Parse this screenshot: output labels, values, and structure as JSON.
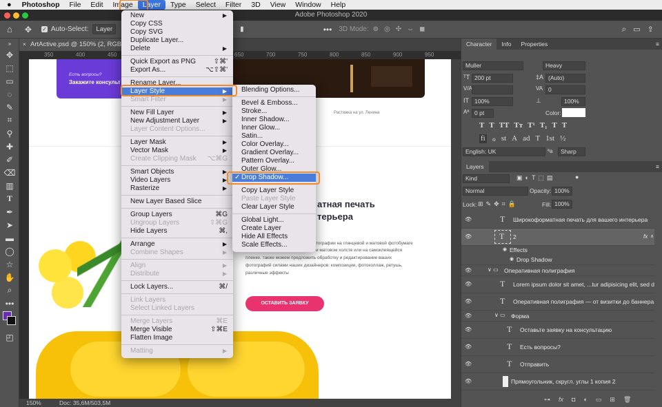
{
  "menubar": {
    "apple": "",
    "items": [
      "Photoshop",
      "File",
      "Edit",
      "Image",
      "Layer",
      "Type",
      "Select",
      "Filter",
      "3D",
      "View",
      "Window",
      "Help"
    ]
  },
  "window": {
    "title": "Adobe Photoshop 2020"
  },
  "options_bar": {
    "auto_select_label": "Auto-Select:",
    "auto_select_value": "Layer",
    "mode_label": "3D Mode:"
  },
  "document": {
    "tab_title": "ArtActive.psd @ 150% (2, RGB/8) *",
    "ruler_ticks": [
      "350",
      "400",
      "450",
      "500",
      "550",
      "600",
      "650",
      "700",
      "750",
      "800",
      "850",
      "900",
      "950"
    ]
  },
  "status": {
    "zoom": "150%",
    "doc": "Doc: 35,6M/503,5M"
  },
  "canvas": {
    "card_small": "Есть вопросы?",
    "card_big": "Закажите консульт",
    "photo_caption": "Растяжка на ул. Ленина",
    "heading_line1": "атная печать",
    "heading_line2": "терьера",
    "body_lines": [
      "тографии на глянцевой и матовой фотобумаге",
      "и матовом холсте или на самоклеящейся",
      "пленке. также можем предложить обработку и редактирование ваших",
      "фотографий силами наших дизайнеров: композиции, фотоколлаж, ретушь,",
      "различные эффекты"
    ],
    "cta": "ОСТАВИТЬ ЗАЯВКУ"
  },
  "layer_menu": [
    {
      "label": "New",
      "arrow": true
    },
    {
      "label": "Copy CSS"
    },
    {
      "label": "Copy SVG"
    },
    {
      "label": "Duplicate Layer..."
    },
    {
      "label": "Delete",
      "arrow": true
    },
    {
      "sep": true
    },
    {
      "label": "Quick Export as PNG",
      "sc": "⇧⌘'"
    },
    {
      "label": "Export As...",
      "sc": "⌥⇧⌘'"
    },
    {
      "sep": true
    },
    {
      "label": "Rename Layer..."
    },
    {
      "label": "Layer Style",
      "arrow": true,
      "hl": true
    },
    {
      "label": "Smart Filter",
      "arrow": true,
      "dis": true
    },
    {
      "sep": true
    },
    {
      "label": "New Fill Layer",
      "arrow": true
    },
    {
      "label": "New Adjustment Layer",
      "arrow": true
    },
    {
      "label": "Layer Content Options...",
      "dis": true
    },
    {
      "sep": true
    },
    {
      "label": "Layer Mask",
      "arrow": true
    },
    {
      "label": "Vector Mask",
      "arrow": true
    },
    {
      "label": "Create Clipping Mask",
      "sc": "⌥⌘G",
      "dis": true
    },
    {
      "sep": true
    },
    {
      "label": "Smart Objects",
      "arrow": true
    },
    {
      "label": "Video Layers",
      "arrow": true
    },
    {
      "label": "Rasterize",
      "arrow": true
    },
    {
      "sep": true
    },
    {
      "label": "New Layer Based Slice"
    },
    {
      "sep": true
    },
    {
      "label": "Group Layers",
      "sc": "⌘G"
    },
    {
      "label": "Ungroup Layers",
      "sc": "⇧⌘G",
      "dis": true
    },
    {
      "label": "Hide Layers",
      "sc": "⌘,"
    },
    {
      "sep": true
    },
    {
      "label": "Arrange",
      "arrow": true
    },
    {
      "label": "Combine Shapes",
      "arrow": true,
      "dis": true
    },
    {
      "sep": true
    },
    {
      "label": "Align",
      "arrow": true,
      "dis": true
    },
    {
      "label": "Distribute",
      "arrow": true,
      "dis": true
    },
    {
      "sep": true
    },
    {
      "label": "Lock Layers...",
      "sc": "⌘/"
    },
    {
      "sep": true
    },
    {
      "label": "Link Layers",
      "dis": true
    },
    {
      "label": "Select Linked Layers",
      "dis": true
    },
    {
      "sep": true
    },
    {
      "label": "Merge Layers",
      "sc": "⌘E",
      "dis": true
    },
    {
      "label": "Merge Visible",
      "sc": "⇧⌘E"
    },
    {
      "label": "Flatten Image"
    },
    {
      "sep": true
    },
    {
      "label": "Matting",
      "arrow": true,
      "dis": true
    }
  ],
  "style_menu": [
    {
      "label": "Blending Options..."
    },
    {
      "sep": true
    },
    {
      "label": "Bevel & Emboss..."
    },
    {
      "label": "Stroke..."
    },
    {
      "label": "Inner Shadow..."
    },
    {
      "label": "Inner Glow..."
    },
    {
      "label": "Satin..."
    },
    {
      "label": "Color Overlay..."
    },
    {
      "label": "Gradient Overlay..."
    },
    {
      "label": "Pattern Overlay..."
    },
    {
      "label": "Outer Glow..."
    },
    {
      "label": "Drop Shadow...",
      "hl": true,
      "check": "✓"
    },
    {
      "sep": true
    },
    {
      "label": "Copy Layer Style"
    },
    {
      "label": "Paste Layer Style",
      "dis": true
    },
    {
      "label": "Clear Layer Style"
    },
    {
      "sep": true
    },
    {
      "label": "Global Light..."
    },
    {
      "label": "Create Layer"
    },
    {
      "label": "Hide All Effects"
    },
    {
      "label": "Scale Effects..."
    }
  ],
  "character": {
    "tabs": [
      "Character",
      "Info",
      "Properties"
    ],
    "font": "Muller",
    "weight": "Heavy",
    "size": "200 pt",
    "leading": "(Auto)",
    "kerning": "",
    "tracking": "0",
    "v_scale": "100%",
    "h_scale": "100%",
    "baseline": "0 pt",
    "color_label": "Color:",
    "style_glyphs": [
      "T",
      "T",
      "TT",
      "Tт",
      "T¹",
      "T₁",
      "T",
      "T"
    ],
    "ot_glyphs": [
      "fi",
      "ℴ",
      "st",
      "A",
      "ad",
      "T",
      "1st",
      "½"
    ],
    "language": "English: UK",
    "aa_label": "ªa",
    "aa": "Sharp"
  },
  "layers": {
    "title": "Layers",
    "filter": "Kind",
    "blend": "Normal",
    "opacity_label": "Opacity:",
    "opacity": "100%",
    "lock_label": "Lock:",
    "fill_label": "Fill:",
    "fill": "100%",
    "rows": [
      {
        "name": "Широкоформатная печать  для вашего интерьера"
      },
      {
        "name": "2",
        "fx": "fx"
      },
      {
        "name": "Effects"
      },
      {
        "name": "Drop Shadow"
      },
      {
        "name": "Оперативная полиграфия"
      },
      {
        "name": "Lorem ipsum dolor sit amet, ...tur adipisicing elit, sed d"
      },
      {
        "name": "Оперативная полиграфия — от визитки до баннера"
      },
      {
        "name": "Форма"
      },
      {
        "name": "Оставьте заявку на консультацию"
      },
      {
        "name": "Есть вопросы?"
      },
      {
        "name": "Отправить"
      },
      {
        "name": "Прямоугольник, скругл. углы 1 копия 2"
      }
    ]
  },
  "colors": {
    "accent": "#4a7cd9",
    "highlight_ring": "#f08a2c",
    "cta": "#e8336e",
    "purple": "#6b3bd8",
    "fg_swatch": "#6a2bb8"
  }
}
